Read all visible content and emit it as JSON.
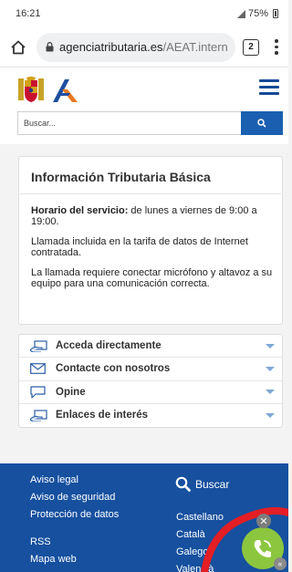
{
  "status_bar": {
    "time": "16:21",
    "battery": "75%"
  },
  "browser": {
    "url_domain": "agenciatributaria.es",
    "url_path": "/AEAT.intern",
    "tab_count": "2"
  },
  "header": {
    "search_placeholder": "Buscar...",
    "icons": {
      "search": "search-icon",
      "menu": "hamburger-menu-icon"
    }
  },
  "info_card": {
    "title": "Información Tributaria Básica",
    "hours_label": "Horario del servicio:",
    "hours_text": " de lunes a viernes de 9:00 a 19:00.",
    "para2": "Llamada incluida en la tarifa de datos de Internet contratada.",
    "para3": "La llamada requiere conectar micrófono y altavoz a su equipo para una comunicación correcta."
  },
  "accordion": {
    "items": [
      {
        "label": "Acceda directamente",
        "icon": "hand-card-icon"
      },
      {
        "label": "Contacte con nosotros",
        "icon": "envelope-icon"
      },
      {
        "label": "Opine",
        "icon": "speech-bubble-icon"
      },
      {
        "label": "Enlaces de interés",
        "icon": "hand-card-icon"
      }
    ]
  },
  "footer": {
    "links": [
      "Aviso legal",
      "Aviso de seguridad",
      "Protección de datos",
      "RSS",
      "Mapa web"
    ],
    "search_label": "Buscar",
    "languages": [
      "Castellano",
      "Català",
      "Galego",
      "Valencià"
    ]
  },
  "colors": {
    "brand_blue": "#16509f",
    "widget_green": "#8cc63f",
    "widget_ring": "#e31e24"
  }
}
